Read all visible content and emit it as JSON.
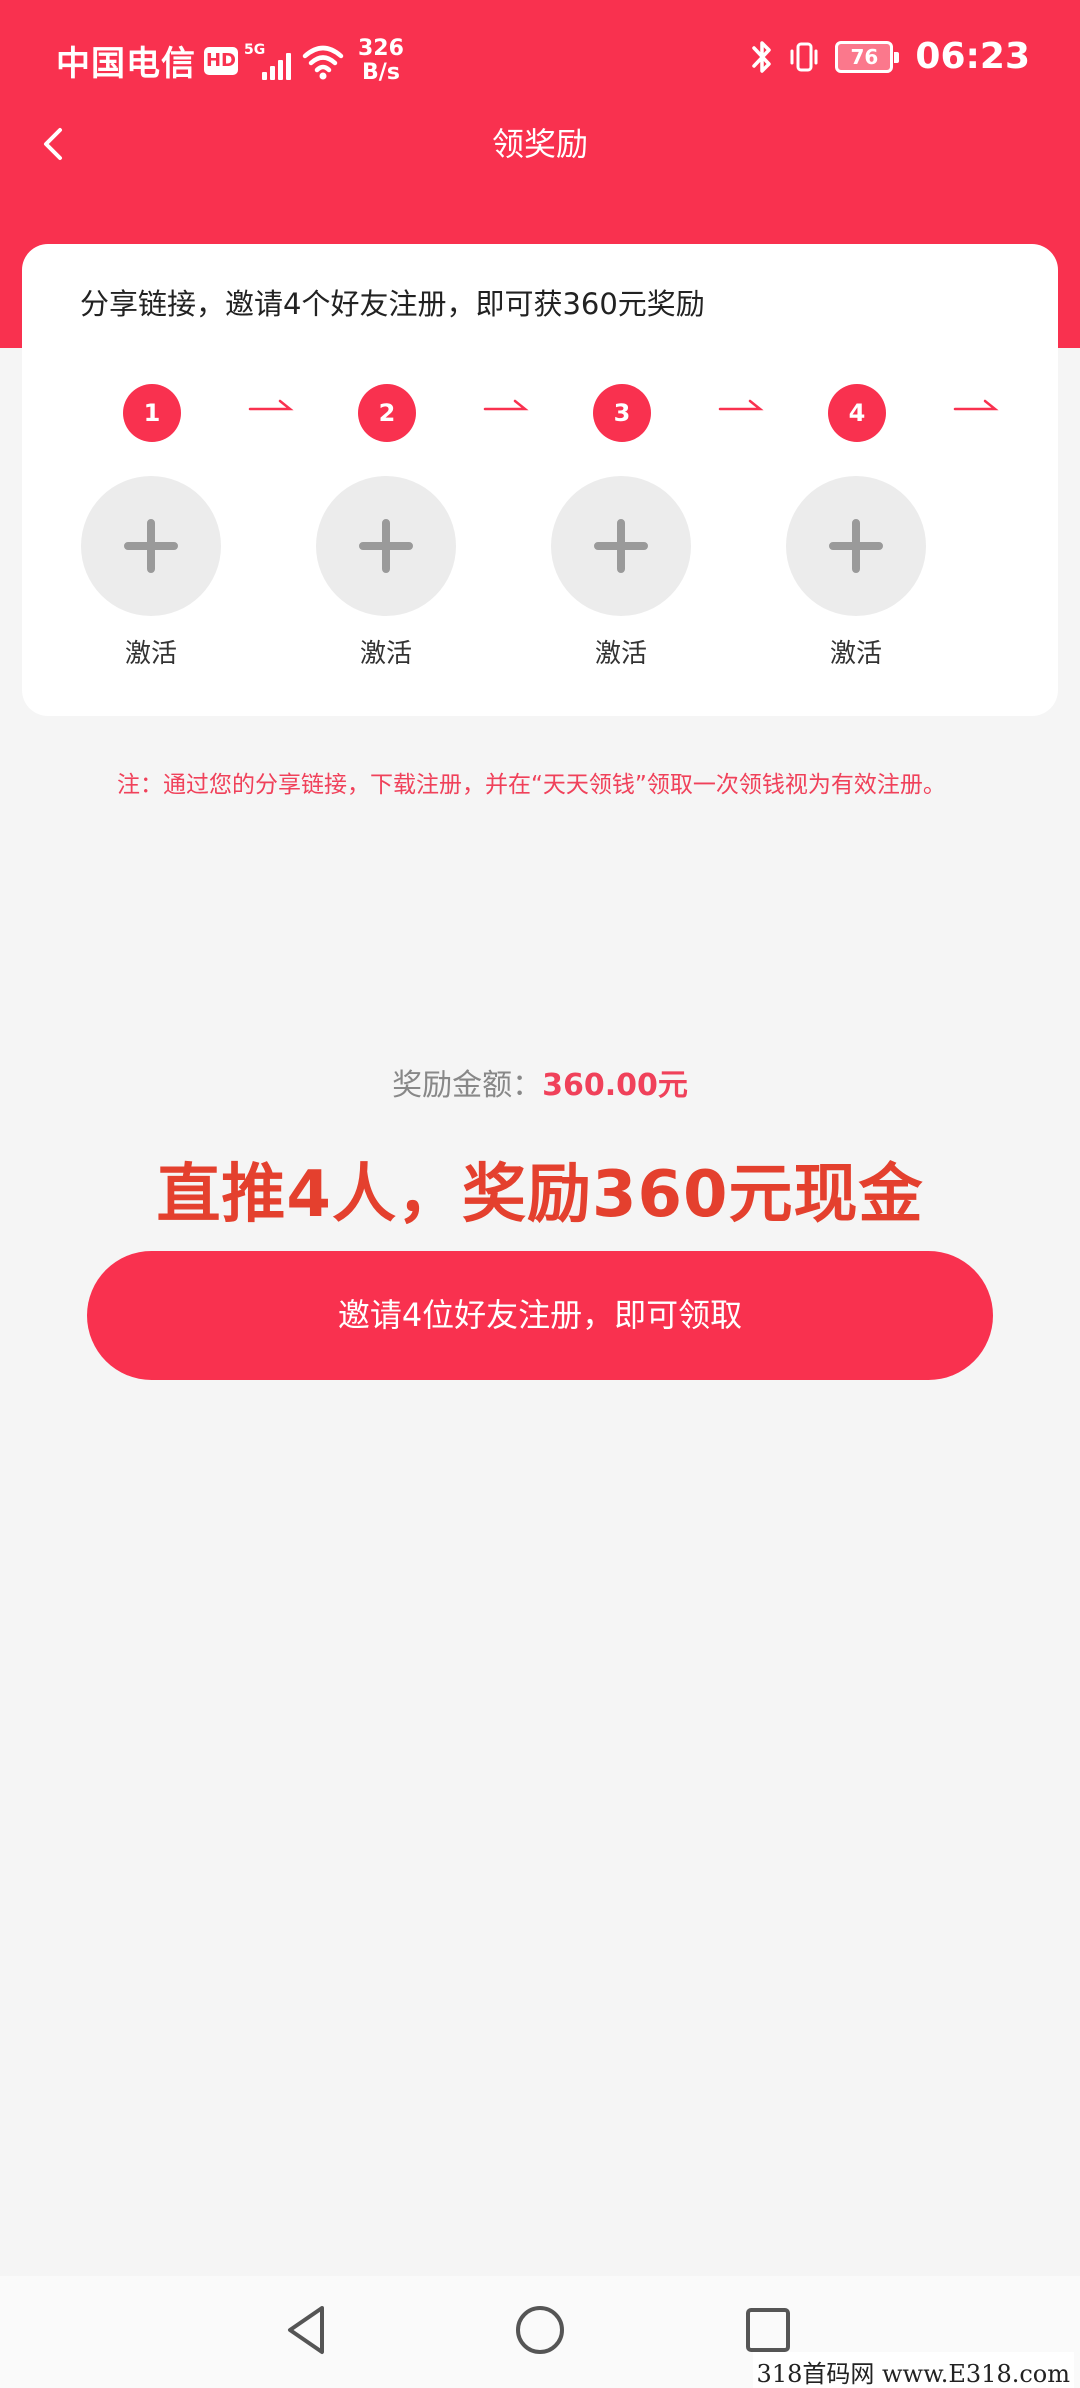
{
  "status_bar": {
    "carrier": "中国电信",
    "hd_badge": "HD",
    "network": "5G",
    "speed_value": "326",
    "speed_unit": "B/s",
    "battery": "76",
    "time": "06:23"
  },
  "nav": {
    "title": "领奖励"
  },
  "invite_card": {
    "description": "分享链接，邀请4个好友注册，即可获360元奖励",
    "steps": [
      {
        "number": "1",
        "label": "激活"
      },
      {
        "number": "2",
        "label": "激活"
      },
      {
        "number": "3",
        "label": "激活"
      },
      {
        "number": "4",
        "label": "激活"
      }
    ]
  },
  "note": "注：通过您的分享链接，下载注册，并在“天天领钱”领取一次领钱视为有效注册。",
  "reward": {
    "label": "奖励金额：",
    "amount": "360.00元"
  },
  "headline": "直推4人，奖励360元现金",
  "cta": {
    "label": "邀请4位好友注册，即可领取"
  },
  "watermark": "318首码网 www.E318.com",
  "colors": {
    "brand_red": "#f9314f",
    "headline_red": "#e4402e",
    "page_bg": "#f5f5f5"
  }
}
